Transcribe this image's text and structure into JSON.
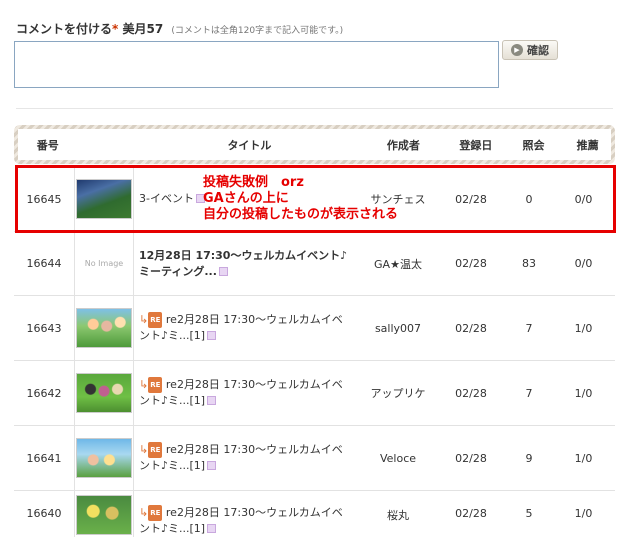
{
  "comment_form": {
    "label": "コメントを付ける",
    "required_mark": "*",
    "username": "美月57",
    "note": "(コメントは全角120字まで記入可能です。)",
    "textarea_value": "",
    "confirm_label": "確認"
  },
  "table": {
    "headers": {
      "number": "番号",
      "title": "タイトル",
      "author": "作成者",
      "date": "登録日",
      "views": "照会",
      "recommend": "推薦"
    },
    "rows": [
      {
        "number": "16645",
        "title": "3-イベント",
        "author": "サンチェス",
        "date": "02/28",
        "views": "0",
        "recommend": "0/0"
      },
      {
        "number": "16644",
        "no_image_label": "No Image",
        "title": "12月28日 17:30～ウェルカムイベント♪ミーティング...",
        "author": "GA★温太",
        "date": "02/28",
        "views": "83",
        "recommend": "0/0"
      },
      {
        "number": "16643",
        "re_label": "RE",
        "title": "re2月28日 17:30～ウェルカムイベント♪ミ...[1]",
        "author": "sally007",
        "date": "02/28",
        "views": "7",
        "recommend": "1/0"
      },
      {
        "number": "16642",
        "re_label": "RE",
        "title": "re2月28日 17:30～ウェルカムイベント♪ミ...[1]",
        "author": "アップリケ",
        "date": "02/28",
        "views": "7",
        "recommend": "1/0"
      },
      {
        "number": "16641",
        "re_label": "RE",
        "title": "re2月28日 17:30～ウェルカムイベント♪ミ...[1]",
        "author": "Veloce",
        "date": "02/28",
        "views": "9",
        "recommend": "1/0"
      },
      {
        "number": "16640",
        "re_label": "RE",
        "title": "re2月28日 17:30～ウェルカムイベント♪ミ...[1]",
        "author": "桜丸",
        "date": "02/28",
        "views": "5",
        "recommend": "1/0"
      }
    ]
  },
  "annotation": {
    "line1": "投稿失敗例　orz",
    "line2": "GAさんの上に",
    "line3": "自分の投稿したものが表示される",
    "color": "#e60000"
  }
}
